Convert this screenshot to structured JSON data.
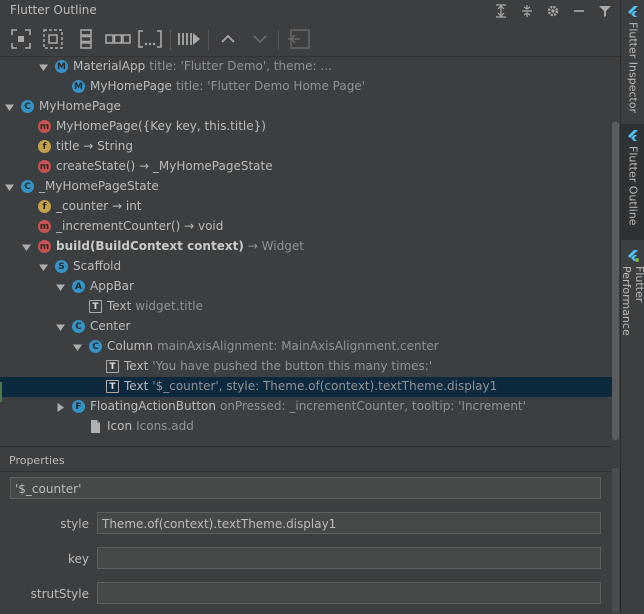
{
  "window": {
    "title": "Flutter Outline"
  },
  "title_icons": [
    "expand-all-icon",
    "collapse-all-icon",
    "settings-gear-icon",
    "minimize-icon",
    "filter-icon"
  ],
  "toolbar": {
    "buttons": [
      {
        "name": "wrap-center-icon"
      },
      {
        "name": "wrap-padding-icon"
      },
      {
        "name": "wrap-column-icon"
      },
      {
        "name": "wrap-row-icon"
      },
      {
        "name": "wrap-container-icon"
      },
      {
        "name": "wrap-streambuilder-icon"
      },
      {
        "name": "move-up-icon"
      },
      {
        "name": "move-down-icon"
      },
      {
        "name": "extract-widget-icon"
      }
    ]
  },
  "tree": [
    {
      "indent": 2,
      "arrow": "down",
      "icon": "M",
      "label": "MaterialApp",
      "sub": "title: 'Flutter Demo', theme: ..."
    },
    {
      "indent": 3,
      "arrow": "",
      "icon": "M",
      "label": "MyHomePage",
      "sub": "title: 'Flutter Demo Home Page'"
    },
    {
      "indent": 0,
      "arrow": "down",
      "icon": "C",
      "label": "MyHomePage",
      "sub": ""
    },
    {
      "indent": 1,
      "arrow": "",
      "icon": "m",
      "label": "MyHomePage({Key key, this.title})",
      "sub": ""
    },
    {
      "indent": 1,
      "arrow": "",
      "icon": "f",
      "label": "title → String",
      "sub": ""
    },
    {
      "indent": 1,
      "arrow": "",
      "icon": "m",
      "label": "createState() → _MyHomePageState",
      "sub": ""
    },
    {
      "indent": 0,
      "arrow": "down",
      "icon": "C",
      "label": "_MyHomePageState",
      "sub": ""
    },
    {
      "indent": 1,
      "arrow": "",
      "icon": "f",
      "label": "_counter → int",
      "sub": ""
    },
    {
      "indent": 1,
      "arrow": "",
      "icon": "m",
      "label": "_incrementCounter() → void",
      "sub": ""
    },
    {
      "indent": 1,
      "arrow": "down",
      "icon": "m",
      "label": "build(BuildContext context)",
      "bold": true,
      "sub": "→ Widget"
    },
    {
      "indent": 2,
      "arrow": "down",
      "icon": "S",
      "label": "Scaffold",
      "sub": ""
    },
    {
      "indent": 3,
      "arrow": "down",
      "icon": "A",
      "label": "AppBar",
      "sub": ""
    },
    {
      "indent": 4,
      "arrow": "",
      "icon": "T",
      "label": "Text",
      "sub": "widget.title"
    },
    {
      "indent": 3,
      "arrow": "down",
      "icon": "C",
      "label": "Center",
      "sub": ""
    },
    {
      "indent": 4,
      "arrow": "down",
      "icon": "C",
      "label": "Column",
      "sub": "mainAxisAlignment: MainAxisAlignment.center"
    },
    {
      "indent": 5,
      "arrow": "",
      "icon": "T",
      "label": "Text",
      "sub": "'You have pushed the button this many times:'"
    },
    {
      "indent": 5,
      "arrow": "",
      "icon": "T",
      "label": "Text",
      "sub": "'$_counter', style: Theme.of(context).textTheme.display1",
      "selected": true
    },
    {
      "indent": 3,
      "arrow": "right",
      "icon": "F",
      "label": "FloatingActionButton",
      "sub": "onPressed: _incrementCounter, tooltip: 'Increment'"
    },
    {
      "indent": 4,
      "arrow": "",
      "icon": "doc",
      "label": "Icon",
      "sub": "Icons.add"
    }
  ],
  "properties": {
    "header": "Properties",
    "value_field": "'$_counter'",
    "rows": [
      {
        "label": "style",
        "value": "Theme.of(context).textTheme.display1"
      },
      {
        "label": "key",
        "value": ""
      },
      {
        "label": "strutStyle",
        "value": ""
      }
    ]
  },
  "sidebar": {
    "tabs": [
      {
        "label": "Flutter Inspector",
        "active": false
      },
      {
        "label": "Flutter Outline",
        "active": true
      },
      {
        "label": "Flutter Performance",
        "active": false
      }
    ]
  }
}
